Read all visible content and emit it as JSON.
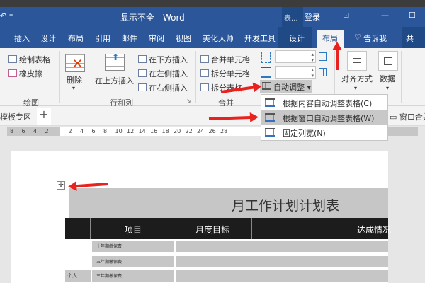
{
  "titlebar": {
    "qat": "↶  ⁼",
    "title": "显示不全  -  Word",
    "context": "表...",
    "login": "登录",
    "restore": "⊡",
    "minimize": "—",
    "maximize": "☐"
  },
  "tabs": [
    "插入",
    "设计",
    "布局",
    "引用",
    "邮件",
    "审阅",
    "视图",
    "美化大师",
    "开发工具",
    "设计",
    "布局"
  ],
  "tellme": "告诉我",
  "share": "共",
  "ribbon": {
    "draw": {
      "draw_table": "绘制表格",
      "eraser": "橡皮擦",
      "label": "绘图"
    },
    "rows": {
      "delete": "删除",
      "insert_above": "在上方插入",
      "insert_below": "在下方插入",
      "insert_left": "在左侧插入",
      "insert_right": "在右侧插入",
      "label": "行和列"
    },
    "merge": {
      "merge_cells": "合并单元格",
      "split_cells": "拆分单元格",
      "split_table": "拆分表格",
      "label": "合并"
    },
    "autofit": "自动调整 ▾",
    "align": "对齐方式",
    "data": "数据"
  },
  "menu": [
    "根据内容自动调整表格(C)",
    "根据窗口自动调整表格(W)",
    "固定列宽(N)"
  ],
  "tabstrip": {
    "templates": "模板专区",
    "add": "+",
    "window_merge": "窗口合并"
  },
  "ruler": [
    "8",
    "6",
    "4",
    "2",
    "",
    "2",
    "4",
    "6",
    "8",
    "10",
    "12",
    "14",
    "16",
    "18",
    "20",
    "22",
    "24",
    "26",
    "28"
  ],
  "doc": {
    "title": "月工作计划计划表",
    "headers": [
      "",
      "项目",
      "月度目标",
      "达成情况"
    ],
    "rows": [
      "十年期缴保费",
      "五年期缴保费",
      "三年期缴保费"
    ],
    "group": "个人"
  }
}
